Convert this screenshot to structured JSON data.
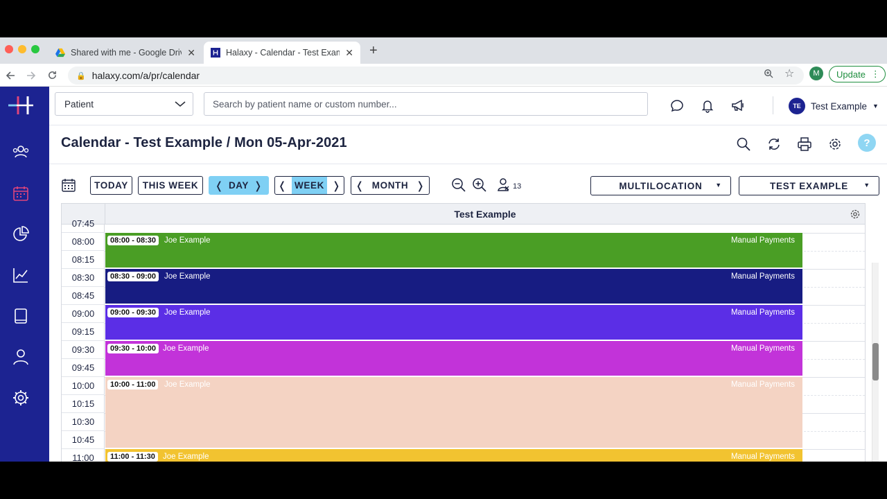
{
  "browser": {
    "tabs": [
      {
        "title": "Shared with me - Google Drive",
        "active": false
      },
      {
        "title": "Halaxy - Calendar - Test Example",
        "active": true
      }
    ],
    "url": "halaxy.com/a/pr/calendar",
    "profile_initial": "M",
    "update_label": "Update"
  },
  "header": {
    "patient_select": "Patient",
    "search_placeholder": "Search by patient name or custom number...",
    "user_initials": "TE",
    "user_name": "Test Example"
  },
  "page": {
    "title": "Calendar - Test Example / Mon 05-Apr-2021",
    "help": "?"
  },
  "toolbar": {
    "today": "TODAY",
    "this_week": "THIS WEEK",
    "day": "DAY",
    "week": "WEEK",
    "month": "MONTH",
    "waitlist_count": "13",
    "location": "MULTILOCATION",
    "practitioner": "TEST EXAMPLE"
  },
  "calendar": {
    "column_title": "Test Example",
    "partial_top_label": "07:45",
    "slots": [
      "08:00",
      "08:15",
      "08:30",
      "08:45",
      "09:00",
      "09:15",
      "09:30",
      "09:45",
      "10:00",
      "10:15",
      "10:30",
      "10:45",
      "11:00"
    ],
    "appointments": [
      {
        "time": "08:00 - 08:30",
        "patient": "Joe Example",
        "payment": "Manual Payments",
        "color": "#4a9e25"
      },
      {
        "time": "08:30 - 09:00",
        "patient": "Joe Example",
        "payment": "Manual Payments",
        "color": "#171c82"
      },
      {
        "time": "09:00 - 09:30",
        "patient": "Joe Example",
        "payment": "Manual Payments",
        "color": "#5b2ee6"
      },
      {
        "time": "09:30 - 10:00",
        "patient": "Joe Example",
        "payment": "Manual Payments",
        "color": "#c233d9"
      },
      {
        "time": "10:00 - 11:00",
        "patient": "Joe Example",
        "payment": "Manual Payments",
        "color": "#f4d3c3"
      },
      {
        "time": "11:00 - 11:30",
        "patient": "Joe Example",
        "payment": "Manual Payments",
        "color": "#f2c330"
      }
    ]
  },
  "colors": {
    "brand_sidebar": "#1c2391",
    "accent": "#7fd0f4",
    "active_nav": "#e0457b"
  }
}
